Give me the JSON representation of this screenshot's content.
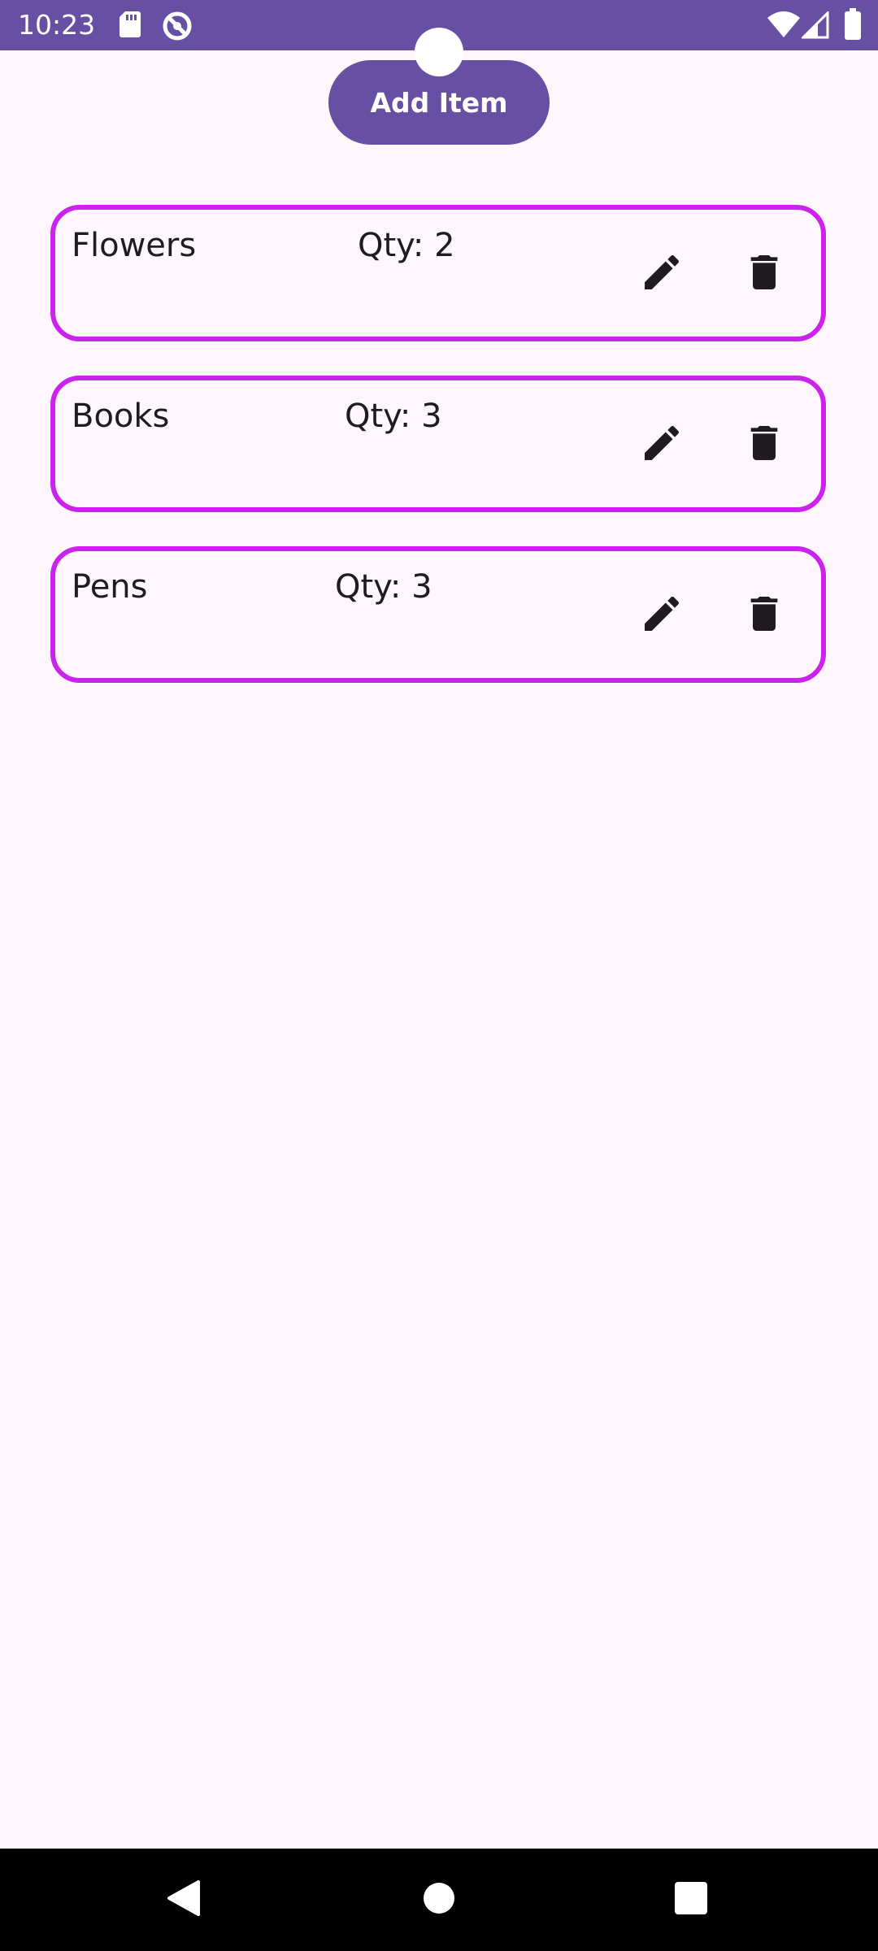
{
  "status_bar": {
    "time": "10:23",
    "icons": [
      "sd-card-icon",
      "do-not-disturb-icon",
      "wifi-icon",
      "signal-icon",
      "battery-icon"
    ],
    "background": "#6750a4"
  },
  "toolbar": {
    "add_label": "Add Item"
  },
  "items": [
    {
      "name": "Flowers",
      "qty": "Qty: 2"
    },
    {
      "name": "Books",
      "qty": "Qty: 3"
    },
    {
      "name": "Pens",
      "qty": "Qty: 3"
    }
  ],
  "colors": {
    "accent": "#6750a4",
    "card_border": "#cc22ee",
    "background": "#fdf7fc",
    "text": "#1f1b20"
  },
  "nav_bar": {
    "icons": [
      "back-icon",
      "home-icon",
      "recents-icon"
    ]
  }
}
